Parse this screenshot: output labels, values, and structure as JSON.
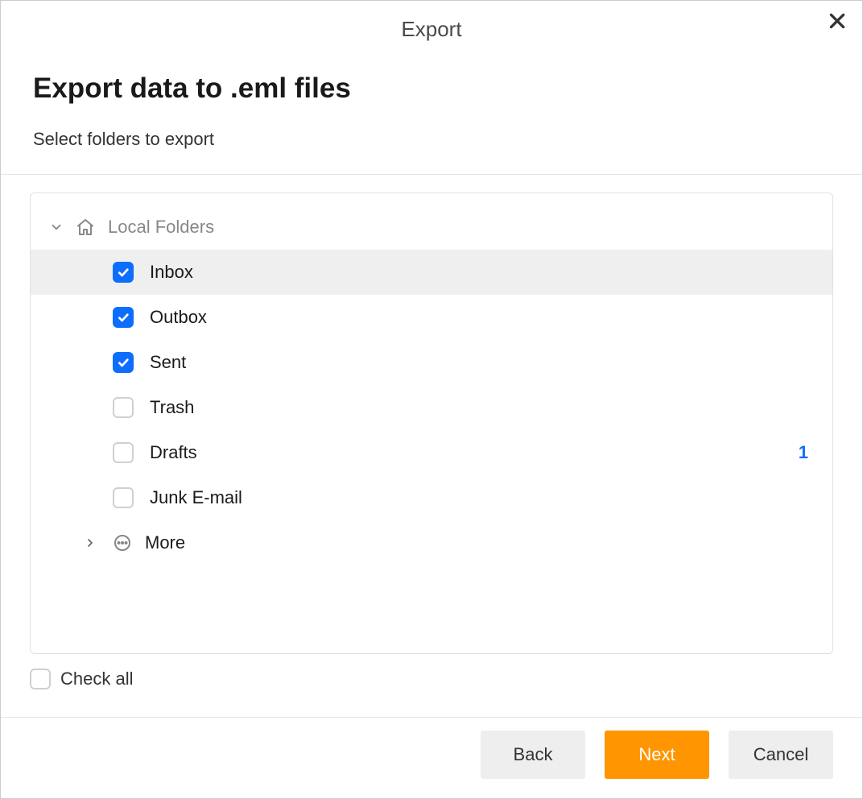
{
  "dialog": {
    "title": "Export"
  },
  "page": {
    "title": "Export data to .eml files",
    "subtitle": "Select folders to export"
  },
  "tree": {
    "root_label": "Local Folders",
    "items": [
      {
        "label": "Inbox",
        "checked": true,
        "selected": true,
        "badge": ""
      },
      {
        "label": "Outbox",
        "checked": true,
        "selected": false,
        "badge": ""
      },
      {
        "label": "Sent",
        "checked": true,
        "selected": false,
        "badge": ""
      },
      {
        "label": "Trash",
        "checked": false,
        "selected": false,
        "badge": ""
      },
      {
        "label": "Drafts",
        "checked": false,
        "selected": false,
        "badge": "1"
      },
      {
        "label": "Junk E-mail",
        "checked": false,
        "selected": false,
        "badge": ""
      }
    ],
    "more_label": "More"
  },
  "check_all_label": "Check all",
  "footer": {
    "back": "Back",
    "next": "Next",
    "cancel": "Cancel"
  }
}
